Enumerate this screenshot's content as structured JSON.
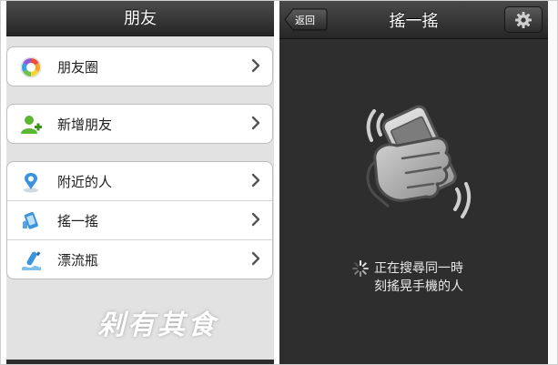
{
  "left": {
    "title": "朋友",
    "groups": [
      {
        "items": [
          {
            "label": "朋友圈",
            "icon": "moments-icon"
          }
        ]
      },
      {
        "items": [
          {
            "label": "新增朋友",
            "icon": "add-friend-icon"
          }
        ]
      },
      {
        "items": [
          {
            "label": "附近的人",
            "icon": "location-pin-icon"
          },
          {
            "label": "搖一搖",
            "icon": "shake-icon"
          },
          {
            "label": "漂流瓶",
            "icon": "drift-bottle-icon"
          }
        ]
      }
    ],
    "watermark": "剁有其食"
  },
  "right": {
    "back_label": "返回",
    "title": "搖一搖",
    "settings_icon": "gear-icon",
    "status_line1": "正在搜尋同一時",
    "status_line2": "刻搖晃手機的人"
  },
  "colors": {
    "navbar": "#2b2b2b",
    "list_background": "#e2e2e2",
    "shake_background": "#2e2e2e"
  }
}
